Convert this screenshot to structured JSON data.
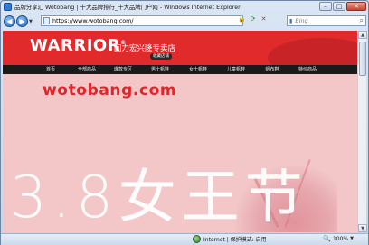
{
  "window": {
    "title": "品牌分享汇 Wotobang | 十大品牌排行_十大品牌门户网 - Windows Internet Explorer"
  },
  "toolbar": {
    "url": "https://www.wotobang.com/",
    "search_placeholder": "Bing"
  },
  "site": {
    "brand": "WARRIOR",
    "brand_mark": "®",
    "brand_sub": "回力宏兴隆专卖店",
    "fav_label": "收藏店铺",
    "menu": [
      "首页",
      "全部商品",
      "爆款专区",
      "男士帆鞋",
      "女士帆鞋",
      "儿童帆鞋",
      "帆布鞋",
      "特价商品"
    ],
    "domain_text": "wotobang.com",
    "promo_text": "3.8女王节"
  },
  "status": {
    "zone": "Internet | 保护模式: 启用",
    "zoom": "100%"
  },
  "colors": {
    "brand_red": "#e0262a",
    "menu_bg": "#1a1a1a",
    "page_bg": "#f3c7c8"
  }
}
